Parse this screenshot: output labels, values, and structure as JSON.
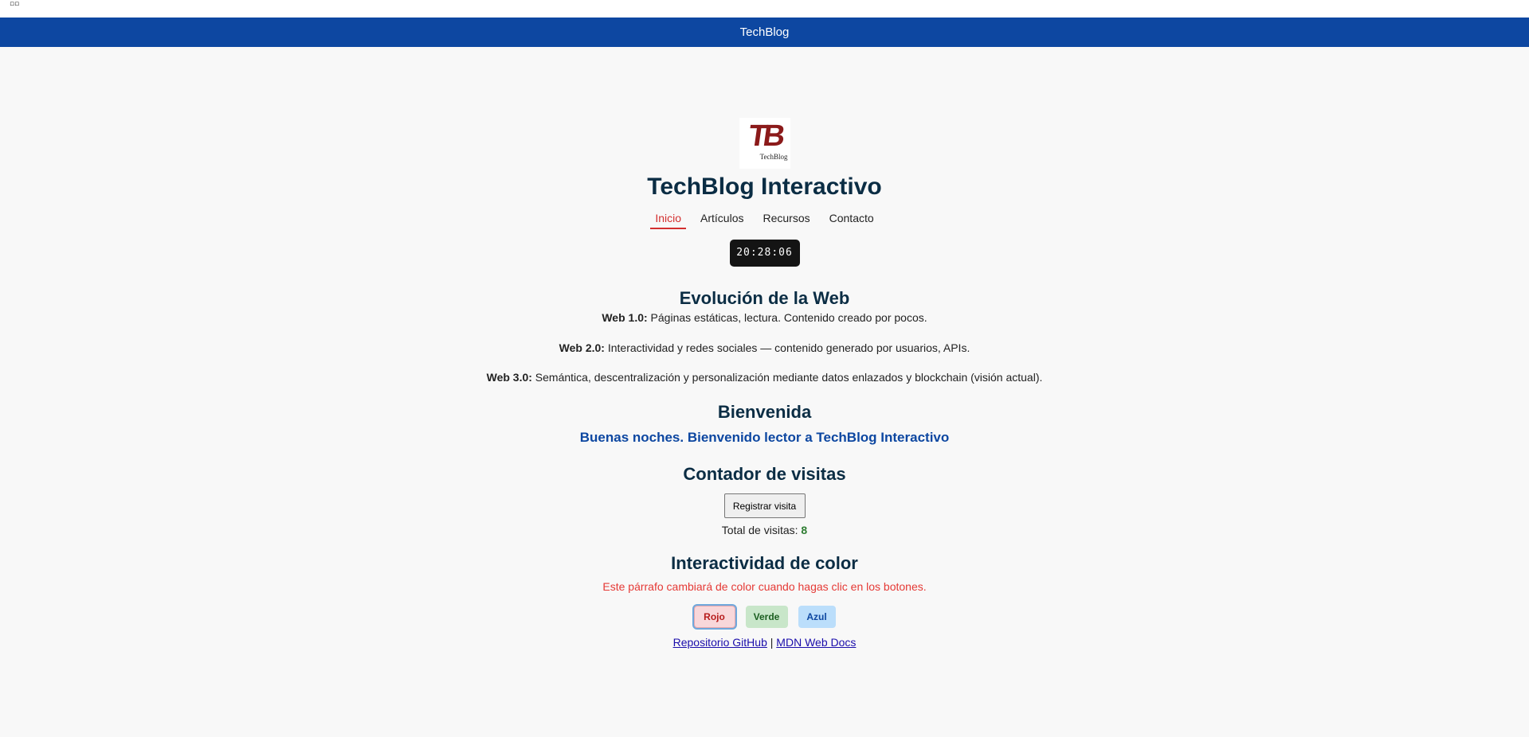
{
  "top": {
    "broken_image_glyph": "▫▫"
  },
  "navbar": {
    "brand": "TechBlog"
  },
  "logo": {
    "text": "TB",
    "subtext": "TechBlog"
  },
  "header": {
    "title": "TechBlog Interactivo"
  },
  "menu": {
    "items": [
      {
        "label": "Inicio",
        "active": true
      },
      {
        "label": "Artículos",
        "active": false
      },
      {
        "label": "Recursos",
        "active": false
      },
      {
        "label": "Contacto",
        "active": false
      }
    ]
  },
  "clock": {
    "time": "20:28:06"
  },
  "evolution": {
    "heading": "Evolución de la Web",
    "items": [
      {
        "label": "Web 1.0:",
        "text": " Páginas estáticas, lectura. Contenido creado por pocos."
      },
      {
        "label": "Web 2.0:",
        "text": " Interactividad y redes sociales — contenido generado por usuarios, APIs."
      },
      {
        "label": "Web 3.0:",
        "text": " Semántica, descentralización y personalización mediante datos enlazados y blockchain (visión actual)."
      }
    ]
  },
  "welcome": {
    "heading": "Bienvenida",
    "greeting": "Buenas noches. Bienvenido lector a TechBlog Interactivo"
  },
  "visits": {
    "heading": "Contador de visitas",
    "button_label": "Registrar visita",
    "total_label": "Total de visitas:",
    "total_value": "8"
  },
  "color": {
    "heading": "Interactividad de color",
    "paragraph": "Este párrafo cambiará de color cuando hagas clic en los botones.",
    "buttons": {
      "red": "Rojo",
      "green": "Verde",
      "blue": "Azul"
    },
    "colors": {
      "red": "#e53935",
      "green": "#2e7d32",
      "blue": "#0d47a1"
    }
  },
  "footer_links": {
    "github": "Repositorio GitHub",
    "separator": "|",
    "mdn": "MDN Web Docs"
  },
  "theme": {
    "navbar_bg": "#0d47a1",
    "title_color": "#0b2d44",
    "active_link": "#d32f2f"
  }
}
